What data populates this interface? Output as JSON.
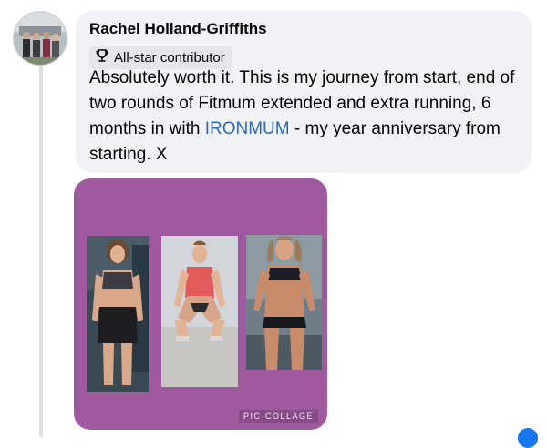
{
  "comment": {
    "author": "Rachel Holland-Griffiths",
    "badge": {
      "icon": "trophy-icon",
      "label": "All-star contributor"
    },
    "text_before_mention": "Absolutely worth it. This is my journey from start, end of two rounds of Fitmum extended and extra running, 6 months in with ",
    "mention": "IRONMUM",
    "text_after_mention": " - my year anniversary from starting. X",
    "attachment": {
      "type": "photo-collage",
      "background_color": "#9f5a9f",
      "watermark": "PIC·COLLAGE",
      "photos": [
        "before-photo",
        "progress-photo",
        "after-photo"
      ]
    }
  },
  "colors": {
    "bubble": "#f0f2f5",
    "mention_link": "#2d6ab3",
    "badge_bg": "#e4e6eb"
  }
}
